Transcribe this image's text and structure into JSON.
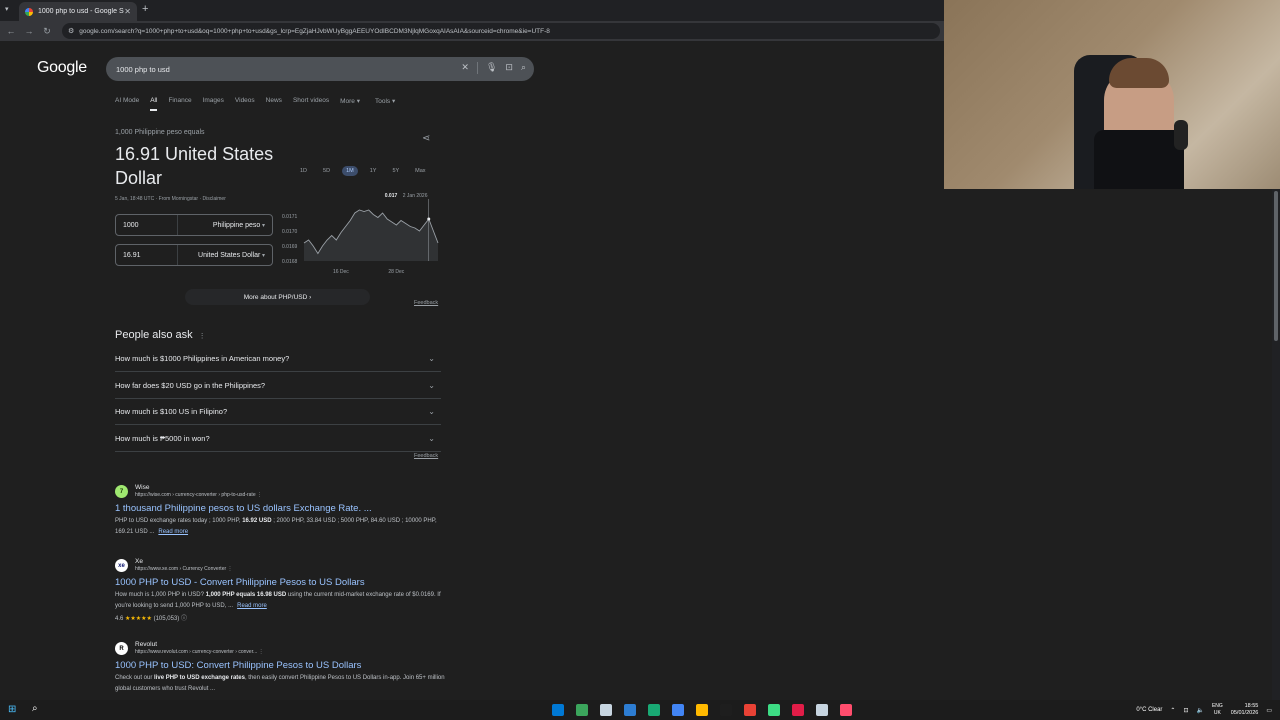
{
  "browser": {
    "tab_title": "1000 php to usd - Google Search",
    "new_tab_label": "+",
    "address": "google.com/search?q=1000+php+to+usd&oq=1000+php+to+usd&gs_lcrp=EgZjaHJvbWUyBggAEEUYOdIBCDM3NjlqMGoxqAIAsAIA&sourceid=chrome&ie=UTF-8"
  },
  "google": {
    "logo": "Google",
    "query": "1000 php to usd",
    "tabs": [
      "AI Mode",
      "All",
      "Finance",
      "Images",
      "Videos",
      "News",
      "Short videos",
      "More ▾",
      "Tools ▾"
    ]
  },
  "converter": {
    "equals_label": "1,000 Philippine peso equals",
    "result": "16.91 United States Dollar",
    "meta": "5 Jan, 18:48 UTC · From Morningstar · Disclaimer",
    "from_amount": "1000",
    "from_currency": "Philippine peso",
    "to_amount": "16.91",
    "to_currency": "United States Dollar",
    "ranges": [
      "1D",
      "5D",
      "1M",
      "1Y",
      "5Y",
      "Max"
    ],
    "selected_range": "1M",
    "more_link": "More about PHP/USD  ›",
    "feedback": "Feedback"
  },
  "chart_data": {
    "type": "area",
    "x": [
      0,
      1,
      2,
      3,
      4,
      5,
      6,
      7,
      8,
      9,
      10,
      11,
      12,
      13,
      14,
      15,
      16,
      17,
      18,
      19,
      20,
      21,
      22,
      23,
      24,
      25,
      26,
      27,
      28,
      29
    ],
    "values": [
      0.01692,
      0.01694,
      0.0169,
      0.01685,
      0.0169,
      0.01694,
      0.01697,
      0.01694,
      0.01699,
      0.01703,
      0.01707,
      0.01712,
      0.01714,
      0.01713,
      0.01714,
      0.01711,
      0.01709,
      0.01712,
      0.01708,
      0.01706,
      0.01704,
      0.01707,
      0.01705,
      0.01703,
      0.01702,
      0.017,
      0.01704,
      0.01708,
      0.017,
      0.01692
    ],
    "y_ticks": [
      "0.0171",
      "0.0170",
      "0.0169",
      "0.0168"
    ],
    "y_tick_values": [
      0.0171,
      0.017,
      0.0169,
      0.0168
    ],
    "x_ticks": [
      "16 Dec",
      "28 Dec"
    ],
    "x_tick_positions": [
      8,
      20
    ],
    "tooltip_value": "0.017",
    "tooltip_date": "2 Jan 2026",
    "tooltip_index": 27,
    "ylim": [
      0.0168,
      0.0172
    ]
  },
  "paa": {
    "title": "People also ask",
    "menu": "⋮",
    "questions": [
      "How much is $1000 Philippines in American money?",
      "How far does $20 USD go in the Philippines?",
      "How much is $100 US in Filipino?",
      "How much is ₱5000 in won?"
    ],
    "feedback": "Feedback"
  },
  "results": [
    {
      "icon_letter": "7",
      "icon_bg": "#9fe870",
      "icon_fg": "#163300",
      "site": "Wise",
      "url": "https://wise.com › currency-converter › php-to-usd-rate  ⋮",
      "title": "1 thousand Philippine pesos to US dollars Exchange Rate. ...",
      "snippet_a": "PHP to USD exchange rates today ; 1000 PHP, ",
      "snippet_b": "16.92 USD",
      "snippet_c": " ; 2000 PHP, 33.84 USD ; 5000 PHP, 84.60 USD ; 10000 PHP, 169.21 USD ...",
      "read_more": "Read more"
    },
    {
      "icon_letter": "xe",
      "icon_bg": "#ffffff",
      "icon_fg": "#0a146e",
      "site": "Xe",
      "url": "https://www.xe.com › Currency Converter  ⋮",
      "title": "1000 PHP to USD - Convert Philippine Pesos to US Dollars",
      "snippet_a": "How much is 1,000 PHP in USD? ",
      "snippet_b": "1,000 PHP equals 16.98 USD",
      "snippet_c": " using the current mid-market exchange rate of $0.0169. If you're looking to send 1,000 PHP to USD, ...",
      "read_more": "Read more",
      "rating": "4.6",
      "stars": "★★★★★",
      "reviews": "(105,053)  ⓘ"
    },
    {
      "icon_letter": "R",
      "icon_bg": "#ffffff",
      "icon_fg": "#000000",
      "site": "Revolut",
      "url": "https://www.revolut.com › currency-converter › conver...  ⋮",
      "title": "1000 PHP to USD: Convert Philippine Pesos to US Dollars",
      "snippet_a": "Check out our ",
      "snippet_b": "live PHP to USD exchange rates",
      "snippet_c": ", then easily convert Philippine Pesos to US Dollars in-app. Join 65+ million global customers who trust Revolut ..."
    }
  ],
  "taskbar": {
    "weather": "0°C  Clear",
    "lang_top": "ENG",
    "lang_bottom": "UK",
    "time": "18:55",
    "date": "05/01/2026",
    "app_colors": [
      "#0078d4",
      "#3ba55c",
      "#c7d5e0",
      "#2d7dd2",
      "#19a974",
      "#4285f4",
      "#ffb900",
      "#1e1e1e",
      "#e94235",
      "#3ddc84",
      "#e11d48",
      "#c7d5e0",
      "#ff4d6d"
    ]
  }
}
